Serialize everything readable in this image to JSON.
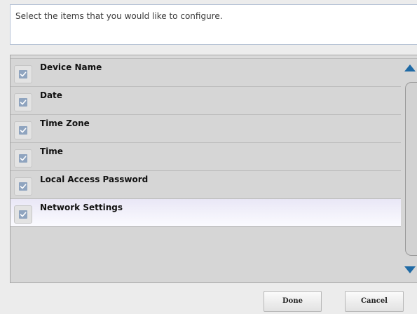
{
  "instruction": {
    "text": "Select the items that you would like to configure."
  },
  "items": [
    {
      "label": "Device Name",
      "checked": true,
      "selected": false
    },
    {
      "label": "Date",
      "checked": true,
      "selected": false
    },
    {
      "label": "Time Zone",
      "checked": true,
      "selected": false
    },
    {
      "label": "Time",
      "checked": true,
      "selected": false
    },
    {
      "label": "Local Access Password",
      "checked": true,
      "selected": false
    },
    {
      "label": "Network Settings",
      "checked": true,
      "selected": true
    }
  ],
  "scrollbar": {
    "up_icon": "triangle-up-icon",
    "down_icon": "triangle-down-icon",
    "color": "#1f6aa5"
  },
  "buttons": {
    "done_label": "Done",
    "cancel_label": "Cancel"
  },
  "colors": {
    "checkbox_fill": "#8fa4bf",
    "selected_row": "#eeecf8",
    "panel_background": "#d6d6d6"
  }
}
